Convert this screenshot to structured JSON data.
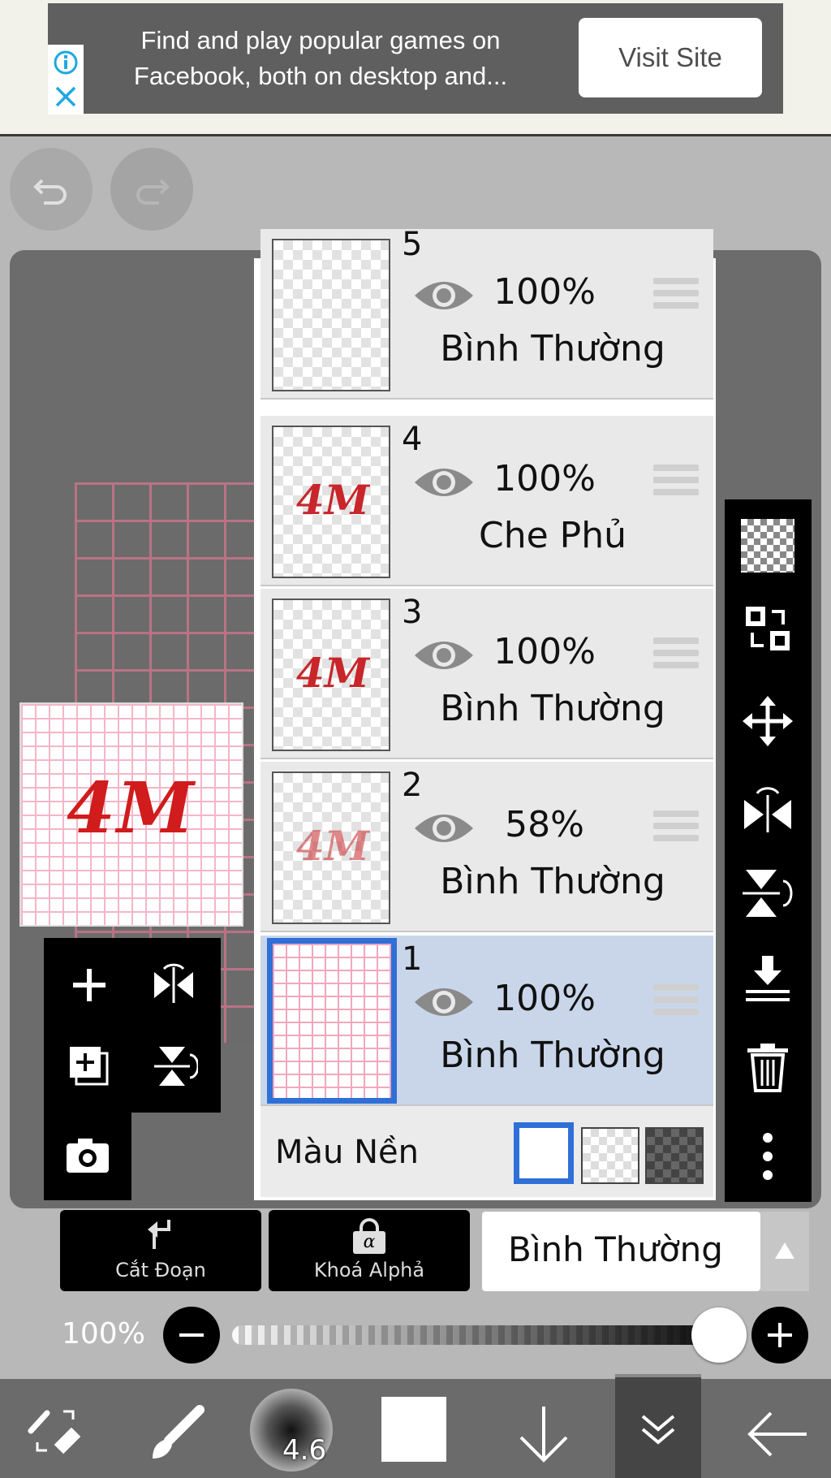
{
  "ad": {
    "text": "Find and play popular games on Facebook, both on desktop and...",
    "button": "Visit Site",
    "info_icon": "info-icon",
    "close_icon": "close-icon"
  },
  "history": {
    "undo_icon": "undo-icon",
    "redo_icon": "redo-icon"
  },
  "canvas": {
    "preview_art": "4M"
  },
  "layers": [
    {
      "number": "5",
      "opacity": "100%",
      "blend": "Bình Thường",
      "art": "",
      "selected": false
    },
    {
      "number": "4",
      "opacity": "100%",
      "blend": "Che Phủ",
      "art": "4M",
      "selected": false
    },
    {
      "number": "3",
      "opacity": "100%",
      "blend": "Bình Thường",
      "art": "4M",
      "selected": false
    },
    {
      "number": "2",
      "opacity": "58%",
      "blend": "Bình Thường",
      "art": "4M",
      "selected": false
    },
    {
      "number": "1",
      "opacity": "100%",
      "blend": "Bình Thường",
      "art": "",
      "selected": true
    }
  ],
  "background": {
    "label": "Màu Nền",
    "options": [
      "white",
      "transparent",
      "dark-checker"
    ],
    "selected": "white"
  },
  "controls": {
    "clip_label": "Cắt Đoạn",
    "alpha_lock_label": "Khoá Alphả",
    "alpha_icon_letter": "α",
    "blend_mode": "Bình Thường"
  },
  "opacity_slider": {
    "label": "100%",
    "value": 1.0
  },
  "bottom_nav": {
    "brush_size": "4.6",
    "color": "#ffffff"
  },
  "colors": {
    "accent": "#2f6fd8",
    "selected_row": "#c9d6ea",
    "art_red": "#c8262a"
  }
}
